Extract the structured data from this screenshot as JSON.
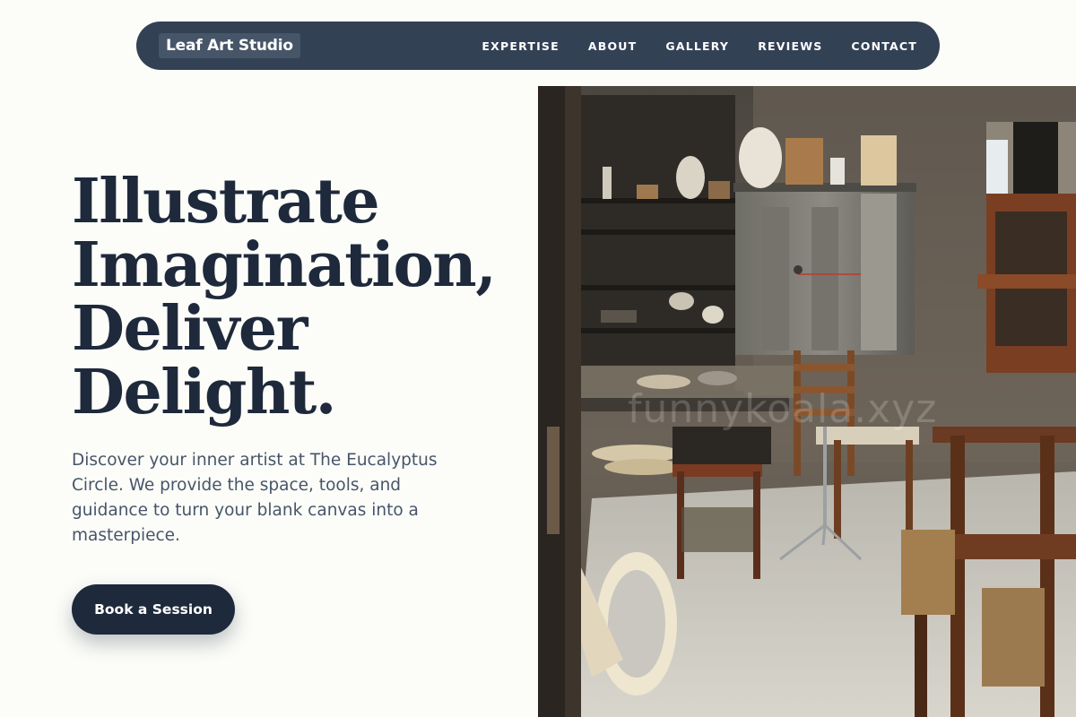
{
  "nav": {
    "brand": "Leaf Art Studio",
    "items": [
      "EXPERTISE",
      "ABOUT",
      "GALLERY",
      "REVIEWS",
      "CONTACT"
    ]
  },
  "hero": {
    "headline": [
      "Illustrate",
      "Imagination,",
      "Deliver",
      "Delight."
    ],
    "lead": "Discover your inner artist at The Eucalyptus Circle. We provide the space, tools, and guidance to turn your blank canvas into a masterpiece.",
    "cta": "Book a Session"
  },
  "photo": {
    "watermark": "funnykoala.xyz"
  },
  "colors": {
    "background": "#fcfdf9",
    "nav_bg": "#334155",
    "brand_bg": "#475569",
    "text_dark": "#1e293b",
    "text_muted": "#475569"
  }
}
